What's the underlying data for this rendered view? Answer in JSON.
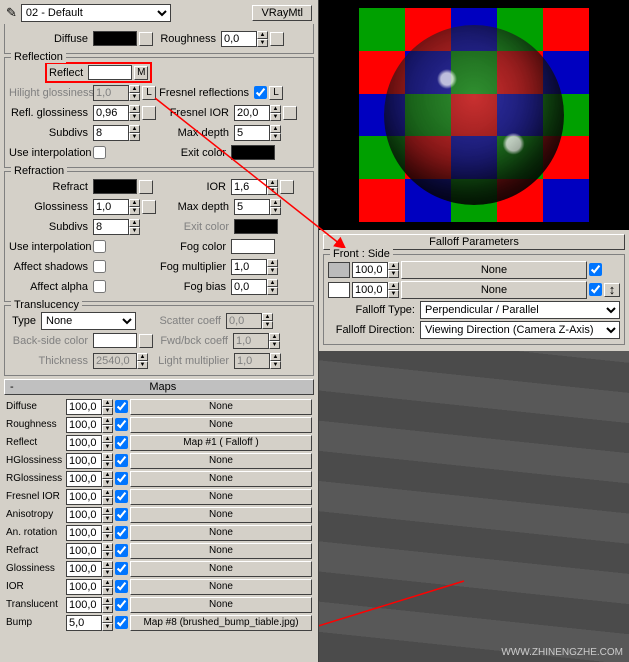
{
  "toolbar": {
    "material_name": "02 - Default",
    "type_btn": "VRayMtl"
  },
  "basic": {
    "diffuse_lbl": "Diffuse",
    "roughness_lbl": "Roughness",
    "roughness_val": "0,0"
  },
  "reflection": {
    "title": "Reflection",
    "reflect_lbl": "Reflect",
    "m_btn": "M",
    "hilight_lbl": "Hilight glossiness",
    "hilight_val": "1,0",
    "l_btn": "L",
    "fresnel_refl_lbl": "Fresnel reflections",
    "refl_gloss_lbl": "Refl. glossiness",
    "refl_gloss_val": "0,96",
    "fresnel_ior_lbl": "Fresnel IOR",
    "fresnel_ior_val": "20,0",
    "subdivs_lbl": "Subdivs",
    "subdivs_val": "8",
    "maxdepth_lbl": "Max depth",
    "maxdepth_val": "5",
    "use_interp_lbl": "Use interpolation",
    "exit_color_lbl": "Exit color"
  },
  "refraction": {
    "title": "Refraction",
    "refract_lbl": "Refract",
    "ior_lbl": "IOR",
    "ior_val": "1,6",
    "gloss_lbl": "Glossiness",
    "gloss_val": "1,0",
    "maxdepth_lbl": "Max depth",
    "maxdepth_val": "5",
    "subdivs_lbl": "Subdivs",
    "subdivs_val": "8",
    "exit_color_lbl": "Exit color",
    "use_interp_lbl": "Use interpolation",
    "fog_color_lbl": "Fog color",
    "affect_shadows_lbl": "Affect shadows",
    "fog_mult_lbl": "Fog multiplier",
    "fog_mult_val": "1,0",
    "affect_alpha_lbl": "Affect alpha",
    "fog_bias_lbl": "Fog bias",
    "fog_bias_val": "0,0"
  },
  "translucency": {
    "title": "Translucency",
    "type_lbl": "Type",
    "type_val": "None",
    "scatter_lbl": "Scatter coeff",
    "scatter_val": "0,0",
    "back_lbl": "Back-side color",
    "fwd_lbl": "Fwd/bck coeff",
    "fwd_val": "1,0",
    "thick_lbl": "Thickness",
    "thick_val": "2540,0",
    "light_lbl": "Light multiplier",
    "light_val": "1,0"
  },
  "maps": {
    "header": "Maps",
    "rows": [
      {
        "label": "Diffuse",
        "val": "100,0",
        "btn": "None"
      },
      {
        "label": "Roughness",
        "val": "100,0",
        "btn": "None"
      },
      {
        "label": "Reflect",
        "val": "100,0",
        "btn": "Map #1  ( Falloff )"
      },
      {
        "label": "HGlossiness",
        "val": "100,0",
        "btn": "None"
      },
      {
        "label": "RGlossiness",
        "val": "100,0",
        "btn": "None"
      },
      {
        "label": "Fresnel IOR",
        "val": "100,0",
        "btn": "None"
      },
      {
        "label": "Anisotropy",
        "val": "100,0",
        "btn": "None"
      },
      {
        "label": "An. rotation",
        "val": "100,0",
        "btn": "None"
      },
      {
        "label": "Refract",
        "val": "100,0",
        "btn": "None"
      },
      {
        "label": "Glossiness",
        "val": "100,0",
        "btn": "None"
      },
      {
        "label": "IOR",
        "val": "100,0",
        "btn": "None"
      },
      {
        "label": "Translucent",
        "val": "100,0",
        "btn": "None"
      },
      {
        "label": "Bump",
        "val": "5,0",
        "btn": "Map #8 (brushed_bump_tiable.jpg)"
      }
    ]
  },
  "falloff": {
    "header": "Falloff Parameters",
    "group": "Front : Side",
    "v1": "100,0",
    "b1": "None",
    "v2": "100,0",
    "b2": "None",
    "type_lbl": "Falloff Type:",
    "type_val": "Perpendicular / Parallel",
    "dir_lbl": "Falloff Direction:",
    "dir_val": "Viewing Direction (Camera Z-Axis)",
    "swap": "↕"
  },
  "watermark": "WWW.ZHINENGZHE.COM",
  "preview_checker": [
    "#00a000",
    "#ff0000",
    "#0000c0",
    "#00a000",
    "#ff0000",
    "#ff0000",
    "#0000c0",
    "#00a000",
    "#ff0000",
    "#0000c0",
    "#0000c0",
    "#00a000",
    "#ff0000",
    "#0000c0",
    "#00a000",
    "#00a000",
    "#ff0000",
    "#0000c0",
    "#00a000",
    "#ff0000",
    "#ff0000",
    "#0000c0",
    "#00a000",
    "#ff0000",
    "#0000c0"
  ]
}
